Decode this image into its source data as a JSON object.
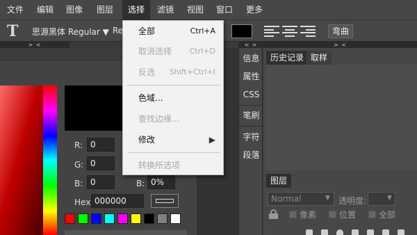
{
  "menubar": {
    "items": [
      "文件",
      "编辑",
      "图像",
      "图层",
      "选择",
      "滤镜",
      "视图",
      "窗口",
      "更多"
    ],
    "active_index": 4
  },
  "options": {
    "tool_icon": "T",
    "font_family": "思源黑体 Regular ▼",
    "font_style": "Re",
    "warp_label": "弯曲",
    "color": "#000000"
  },
  "collapse": {
    "left": "> <",
    "mid": "< >",
    "right": "> <"
  },
  "dropdown": {
    "items": [
      {
        "label": "全部",
        "shortcut": "Ctrl+A",
        "enabled": true
      },
      {
        "label": "取消选择",
        "shortcut": "Ctrl+D",
        "enabled": false
      },
      {
        "label": "反选",
        "shortcut": "Shift+Ctrl+I",
        "enabled": false
      },
      {
        "label": "色域...",
        "shortcut": "",
        "enabled": true
      },
      {
        "label": "查找边缘...",
        "shortcut": "",
        "enabled": false
      },
      {
        "label": "修改",
        "shortcut": "▶",
        "enabled": true
      },
      {
        "label": "转换所选项",
        "shortcut": "",
        "enabled": false
      }
    ]
  },
  "color_panel": {
    "r_label": "R:",
    "r_value": "0",
    "g_label": "G:",
    "g_value": "0",
    "b_label": "B:",
    "b_value": "0",
    "b2_label": "B:",
    "b2_value": "0%",
    "hex_label": "Hex:",
    "hex_value": "000000",
    "swatches": [
      "#ff0000",
      "#00ff00",
      "#0000ff",
      "#00ffff",
      "#ff00ff",
      "#ffff00",
      "#000000",
      "#808080",
      "#ffffff"
    ]
  },
  "vtabs": [
    "信息",
    "属性",
    "CSS",
    "笔刷",
    "字符",
    "段落"
  ],
  "right_panel": {
    "tabs": [
      "历史记录",
      "取样"
    ],
    "layers_tab": "图层",
    "blend_mode": "Normal",
    "opacity_label": "透明度:",
    "lock_pixels": "像素",
    "lock_position": "位置",
    "lock_all": "全部"
  }
}
